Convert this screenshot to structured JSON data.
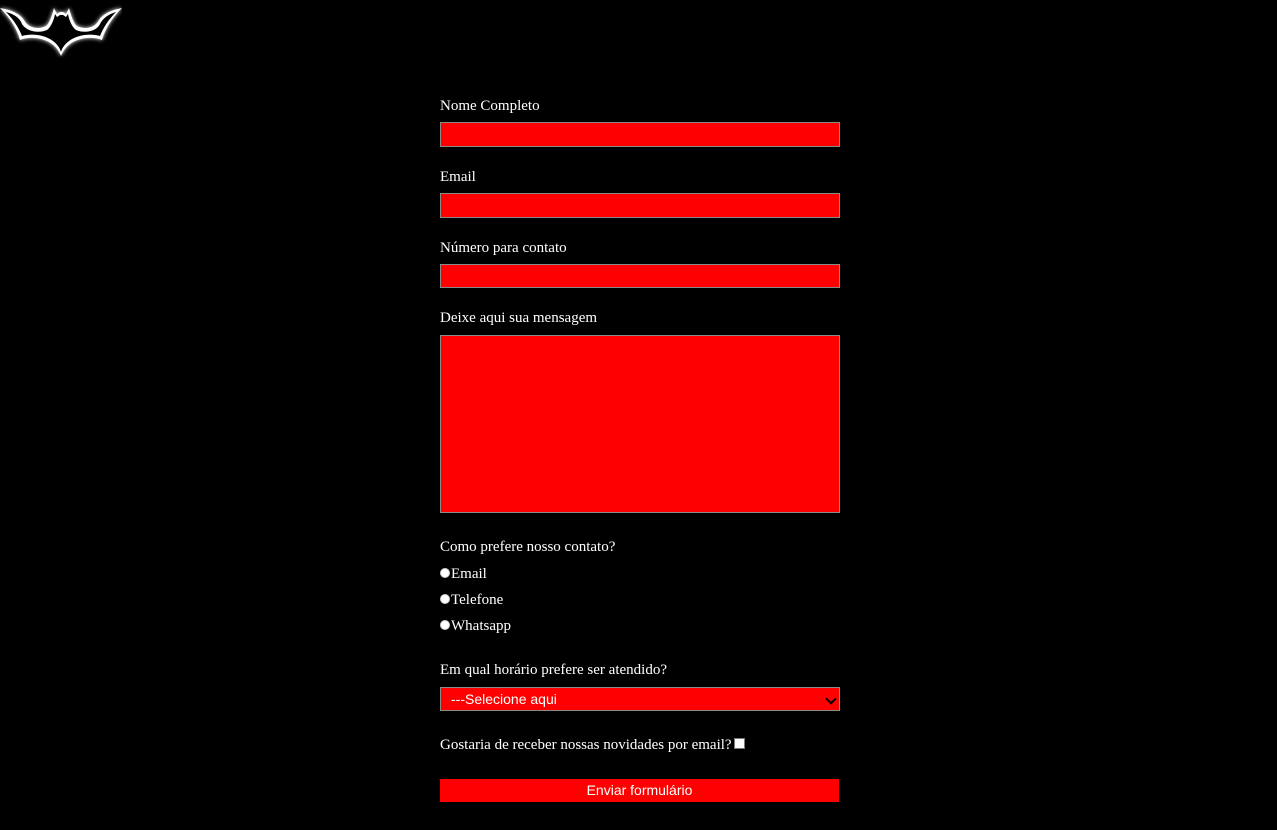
{
  "logo": {
    "icon": "batman-logo-icon"
  },
  "form": {
    "name_label": "Nome Completo",
    "name_value": "",
    "email_label": "Email",
    "email_value": "",
    "phone_label": "Número para contato",
    "phone_value": "",
    "message_label": "Deixe aqui sua mensagem",
    "message_value": "",
    "contact_pref_label": "Como prefere nosso contato?",
    "contact_options": [
      "Email",
      "Telefone",
      "Whatsapp"
    ],
    "schedule_label": "Em qual horário prefere ser atendido?",
    "schedule_selected": "---Selecione aqui",
    "newsletter_label": "Gostaria de receber nossas novidades por email?",
    "newsletter_checked": false,
    "submit_label": "Enviar formulário"
  },
  "colors": {
    "background": "#000000",
    "field": "#ff0000",
    "text": "#ffffff"
  }
}
